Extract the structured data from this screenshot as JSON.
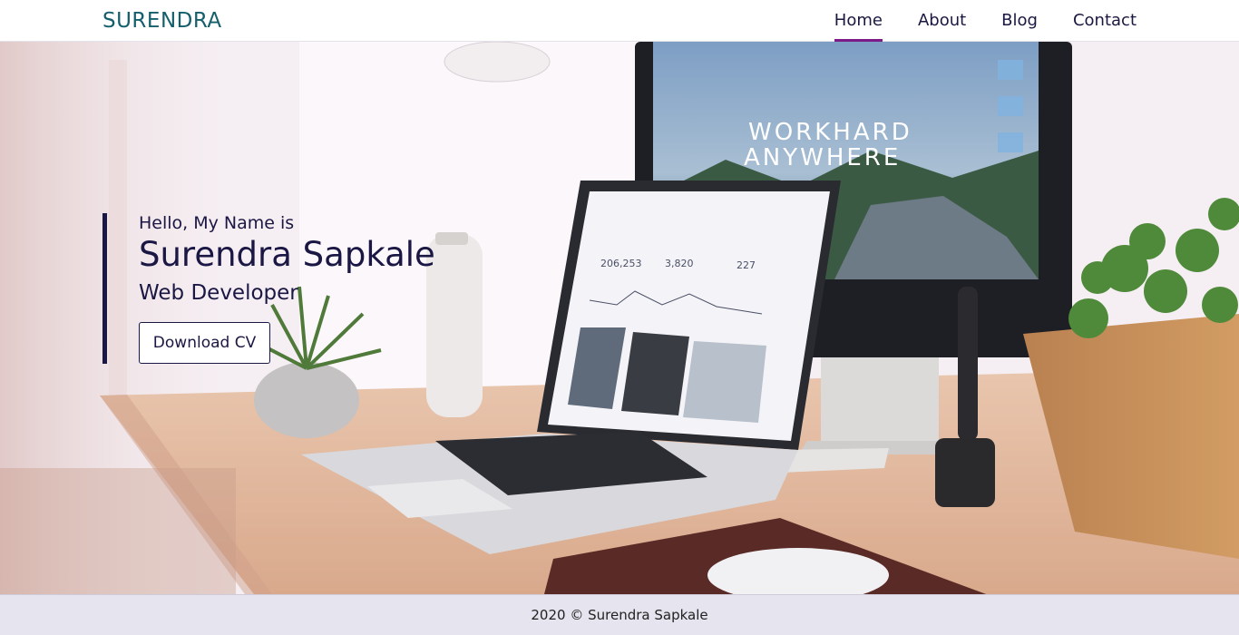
{
  "header": {
    "brand": "SURENDRA",
    "nav": [
      {
        "label": "Home",
        "active": true
      },
      {
        "label": "About",
        "active": false
      },
      {
        "label": "Blog",
        "active": false
      },
      {
        "label": "Contact",
        "active": false
      }
    ]
  },
  "hero": {
    "greeting": "Hello, My Name is",
    "name": "Surendra Sapkale",
    "role": "Web Developer",
    "cta_label": "Download CV",
    "monitor_text_line1": "WORKHARD",
    "monitor_text_line2": "ANYWHERE",
    "laptop_stats": [
      "206,253",
      "3,820",
      "227"
    ]
  },
  "footer": {
    "copyright": "2020 © Surendra Sapkale"
  },
  "colors": {
    "accent": "#7c1b87",
    "brand": "#155e6b",
    "text_dark": "#1b1744"
  }
}
